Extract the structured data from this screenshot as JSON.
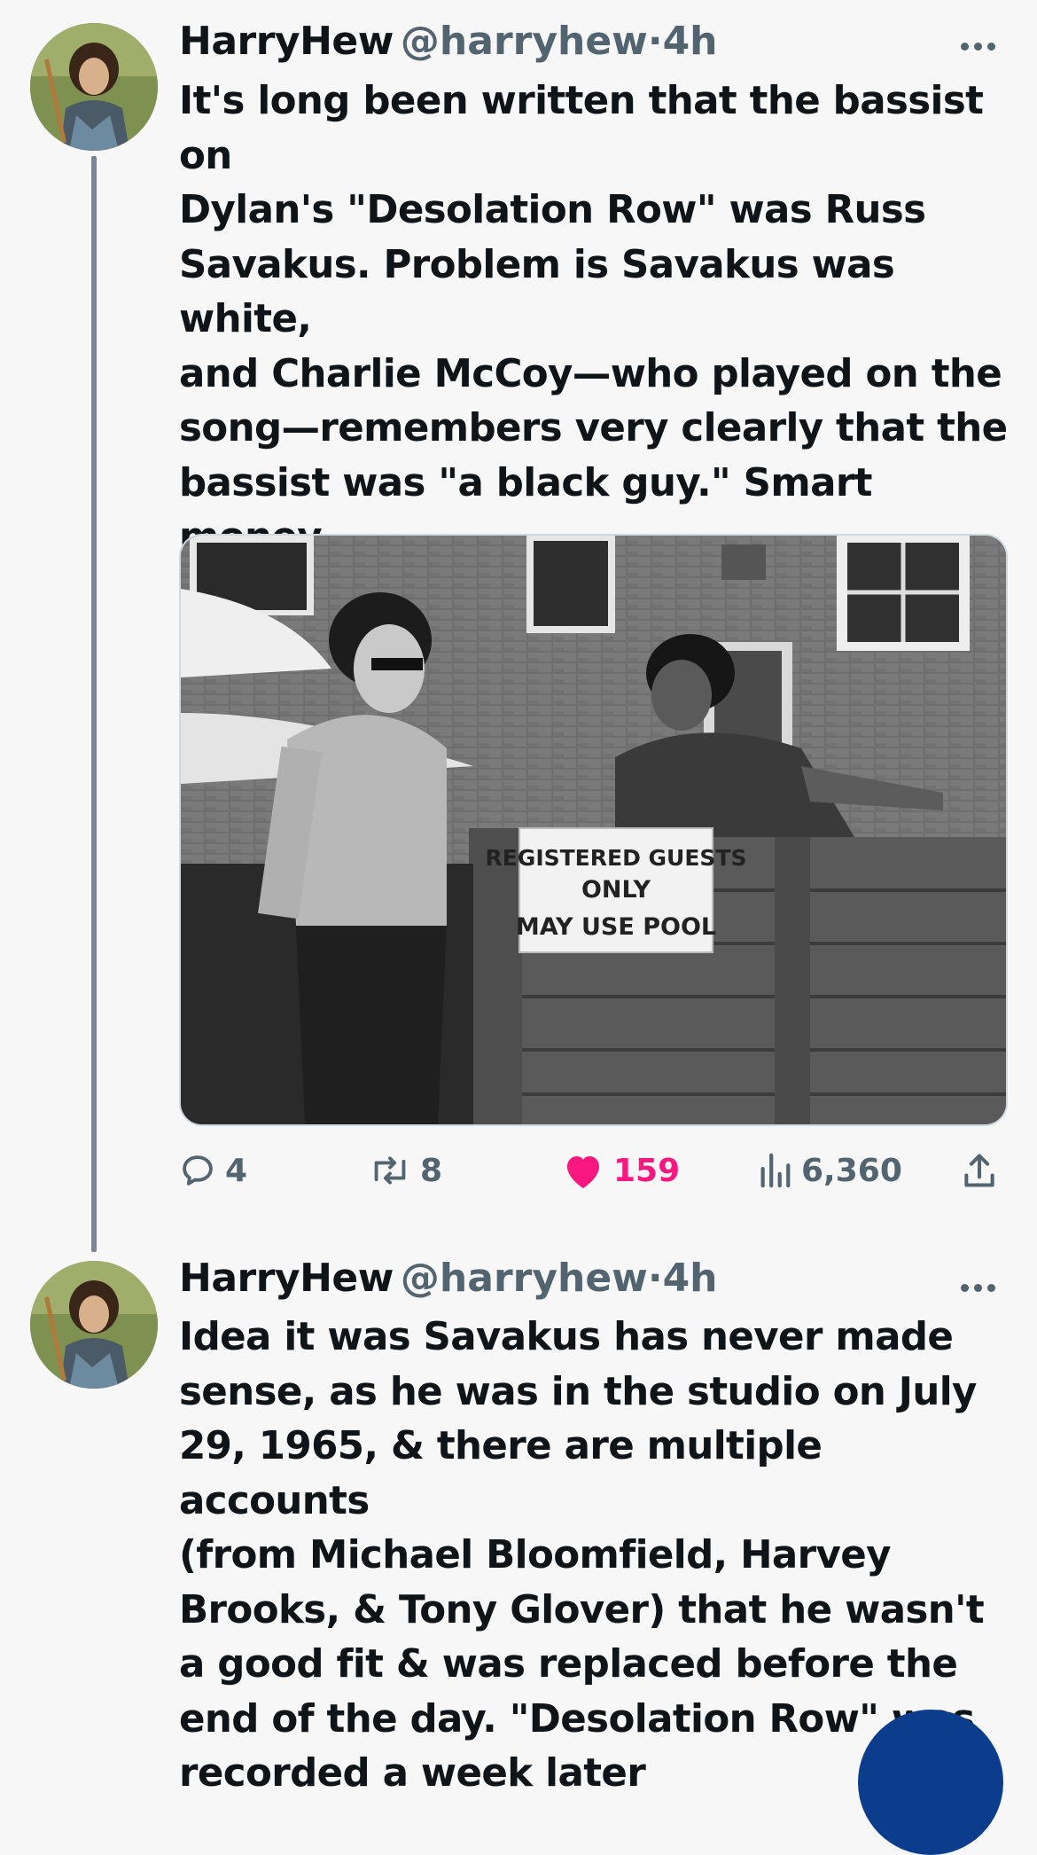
{
  "tweets": [
    {
      "name": "HarryHew",
      "handle": "@harryhew",
      "separator": "·",
      "time": "4h",
      "text": "It's long been written that the bassist on\nDylan's \"Desolation Row\" was Russ\nSavakus. Problem is Savakus was white,\nand Charlie McCoy—who played on the\nsong—remembers very clearly that the\nbassist was \"a black guy.\" Smart money\nsays it was Bill Lee. May he rest in\npeace.",
      "photo_sign": [
        "REGISTERED GUESTS",
        "ONLY",
        "MAY USE POOL"
      ],
      "stats": {
        "replies": "4",
        "retweets": "8",
        "likes": "159",
        "views": "6,360"
      }
    },
    {
      "name": "HarryHew",
      "handle": "@harryhew",
      "separator": "·",
      "time": "4h",
      "text": "Idea it was Savakus has never made\nsense, as he was in the studio on July\n29, 1965, & there are multiple accounts\n(from Michael Bloomfield, Harvey\nBrooks, & Tony Glover) that he wasn't\na good fit & was replaced before the\nend of the day. \"Desolation Row\" was\nrecorded a week later"
    }
  ],
  "colors": {
    "like": "#f91880",
    "muted": "#536471",
    "thread_line": "#7b8594",
    "fab": "#0c3c8c"
  }
}
